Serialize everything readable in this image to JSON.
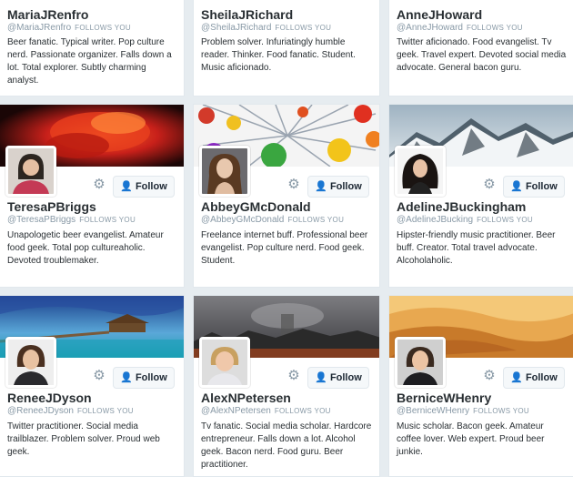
{
  "cards": [
    {
      "name": "MariaJRenfro",
      "handle": "@MariaJRenfro",
      "follows_you": "FOLLOWS YOU",
      "bio": "Beer fanatic. Typical writer. Pop culture nerd. Passionate organizer. Falls down a lot. Total explorer. Subtly charming analyst."
    },
    {
      "name": "SheilaJRichard",
      "handle": "@SheilaJRichard",
      "follows_you": "FOLLOWS YOU",
      "bio": "Problem solver. Infuriatingly humble reader. Thinker. Food fanatic. Student. Music aficionado."
    },
    {
      "name": "AnneJHoward",
      "handle": "@AnneJHoward",
      "follows_you": "FOLLOWS YOU",
      "bio": "Twitter aficionado. Food evangelist. Tv geek. Travel expert. Devoted social media advocate. General bacon guru."
    },
    {
      "name": "TeresaPBriggs",
      "handle": "@TeresaPBriggs",
      "follows_you": "FOLLOWS YOU",
      "bio": "Unapologetic beer evangelist. Amateur food geek. Total pop cultureaholic. Devoted troublemaker.",
      "follow": "Follow"
    },
    {
      "name": "AbbeyGMcDonald",
      "handle": "@AbbeyGMcDonald",
      "follows_you": "FOLLOWS YOU",
      "bio": "Freelance internet buff. Professional beer evangelist. Pop culture nerd. Food geek. Student.",
      "follow": "Follow"
    },
    {
      "name": "AdelineJBuckingham",
      "handle": "@AdelineJBucking",
      "follows_you": "FOLLOWS YOU",
      "bio": "Hipster-friendly music practitioner. Beer buff. Creator. Total travel advocate. Alcoholaholic.",
      "follow": "Follow"
    },
    {
      "name": "ReneeJDyson",
      "handle": "@ReneeJDyson",
      "follows_you": "FOLLOWS YOU",
      "bio": "Twitter practitioner. Social media trailblazer. Problem solver. Proud web geek.",
      "follow": "Follow"
    },
    {
      "name": "AlexNPetersen",
      "handle": "@AlexNPetersen",
      "follows_you": "FOLLOWS YOU",
      "bio": "Tv fanatic. Social media scholar. Hardcore entrepreneur. Falls down a lot. Alcohol geek. Bacon nerd. Food guru. Beer practitioner.",
      "follow": "Follow"
    },
    {
      "name": "BerniceWHenry",
      "handle": "@BerniceWHenry",
      "follows_you": "FOLLOWS YOU",
      "bio": "Music scholar. Bacon geek. Amateur coffee lover. Web expert. Proud beer junkie.",
      "follow": "Follow"
    }
  ],
  "icons": {
    "settings": "gear-icon",
    "follow": "person-add-icon"
  },
  "colors": {
    "accent": "#55acee",
    "text": "#292f33",
    "muted": "#8899a6"
  }
}
